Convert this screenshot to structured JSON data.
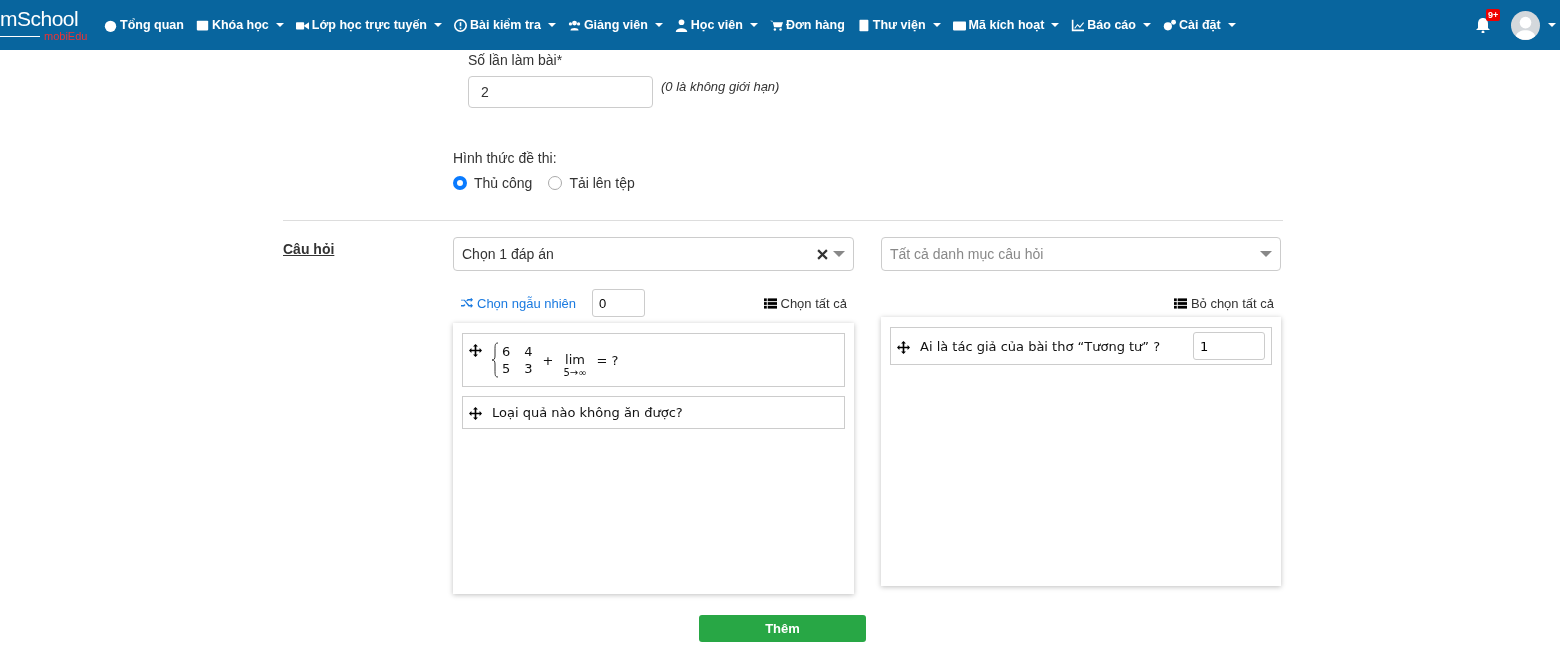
{
  "navbar": {
    "logo": {
      "main": "mSchool",
      "sub": "mobiEdu"
    },
    "items": [
      {
        "label": "Tổng quan",
        "dropdown": false
      },
      {
        "label": "Khóa học",
        "dropdown": true
      },
      {
        "label": "Lớp học trực tuyến",
        "dropdown": true
      },
      {
        "label": "Bài kiểm tra",
        "dropdown": true
      },
      {
        "label": "Giảng viên",
        "dropdown": true
      },
      {
        "label": "Học viên",
        "dropdown": true
      },
      {
        "label": "Đơn hàng",
        "dropdown": false
      },
      {
        "label": "Thư viện",
        "dropdown": true
      },
      {
        "label": "Mã kích hoạt",
        "dropdown": true
      },
      {
        "label": "Báo cáo",
        "dropdown": true
      },
      {
        "label": "Cài đặt",
        "dropdown": true
      }
    ],
    "notifications": {
      "badge": "9+"
    }
  },
  "attempts": {
    "label": "Số lần làm bài*",
    "value": "2",
    "hint": "(0 là không giới hạn)"
  },
  "exam_type": {
    "label": "Hình thức đề thi:",
    "options": [
      {
        "label": "Thủ công",
        "selected": true
      },
      {
        "label": "Tải lên tệp",
        "selected": false
      }
    ]
  },
  "questions": {
    "label": "Câu hỏi",
    "type_select": {
      "value": "Chọn 1 đáp án"
    },
    "category_select": {
      "placeholder": "Tất cả danh mục câu hỏi"
    },
    "random": {
      "label": "Chọn ngẫu nhiên",
      "value": "0"
    },
    "select_all": "Chọn tất cả",
    "deselect_all": "Bỏ chọn tất cả",
    "available": [
      {
        "kind": "math",
        "matrix": [
          [
            "6",
            "4"
          ],
          [
            "5",
            "3"
          ]
        ],
        "operator": "+",
        "lim": "lim",
        "lim_sub": "5→∞",
        "tail": "= ?"
      },
      {
        "kind": "text",
        "text": "Loại quả nào không ăn được?"
      }
    ],
    "chosen": [
      {
        "text": "Ai là tác giả của bài thơ “Tương tư” ?",
        "score": "1"
      }
    ]
  },
  "submit": "Thêm"
}
